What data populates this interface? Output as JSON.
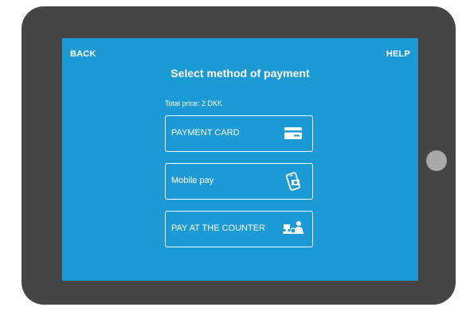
{
  "header": {
    "back_label": "BACK",
    "help_label": "HELP",
    "title": "Select method of payment"
  },
  "total_price": "Total price: 2 DKK",
  "options": [
    {
      "label": "PAYMENT CARD",
      "icon": "credit-card-icon"
    },
    {
      "label": "Mobile pay",
      "icon": "mobile-pay-icon"
    },
    {
      "label": "PAY AT THE COUNTER",
      "icon": "counter-cashier-icon"
    }
  ],
  "colors": {
    "screen_bg": "#1c9ad6",
    "device_frame": "#454545",
    "text": "#ffffff"
  }
}
